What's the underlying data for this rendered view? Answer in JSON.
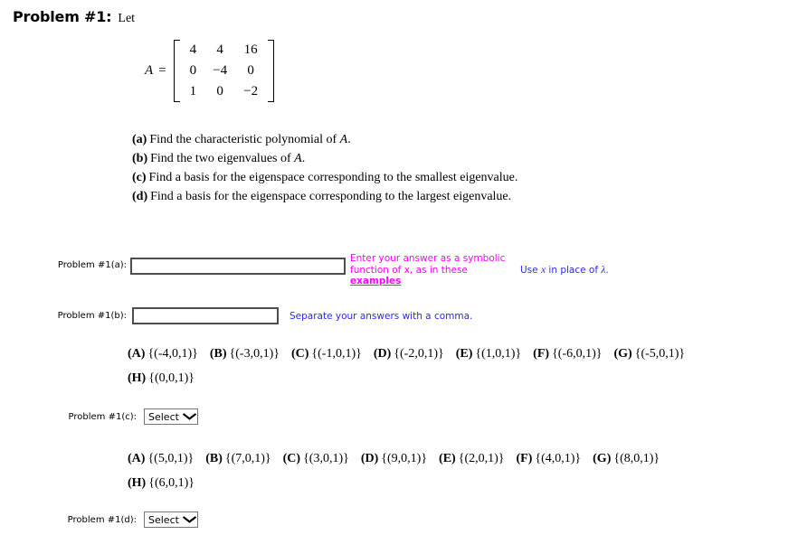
{
  "header": {
    "problem_title": "Problem #1:",
    "intro": "Let"
  },
  "matrix": {
    "lhs": "A",
    "equals": "=",
    "rows": [
      [
        "4",
        "4",
        "16"
      ],
      [
        "0",
        "−4",
        "0"
      ],
      [
        "1",
        "0",
        "−2"
      ]
    ]
  },
  "subquestions": [
    {
      "label": "(a)",
      "text_before": "Find the characteristic polynomial of",
      "var": "A",
      "text_after": "."
    },
    {
      "label": "(b)",
      "text_before": "Find the two eigenvalues of",
      "var": "A",
      "text_after": "."
    },
    {
      "label": "(c)",
      "text_before": "Find a basis for the eigenspace corresponding to the smallest eigenvalue.",
      "var": "",
      "text_after": ""
    },
    {
      "label": "(d)",
      "text_before": "Find a basis for the eigenspace corresponding to the largest eigenvalue.",
      "var": "",
      "text_after": ""
    }
  ],
  "answers": {
    "part_a": {
      "label": "Problem #1(a):",
      "value": "",
      "placeholder": "",
      "hint_magenta_line1": "Enter your answer as a symbolic",
      "hint_magenta_line2": "function of x, as in these",
      "hint_link": "examples",
      "hint_blue_prefix": "Use ",
      "hint_blue_var": "x",
      "hint_blue_middle": " in place of ",
      "hint_blue_lambda": "λ",
      "hint_blue_suffix": "."
    },
    "part_b": {
      "label": "Problem #1(b):",
      "value": "",
      "placeholder": "",
      "hint_blue": "Separate your answers with a comma."
    },
    "part_c": {
      "label": "Problem #1(c):",
      "select_value": "Select",
      "caret": "⌄",
      "choices": [
        {
          "key": "(A)",
          "value": "{(-4,0,1)}"
        },
        {
          "key": "(B)",
          "value": "{(-3,0,1)}"
        },
        {
          "key": "(C)",
          "value": "{(-1,0,1)}"
        },
        {
          "key": "(D)",
          "value": "{(-2,0,1)}"
        },
        {
          "key": "(E)",
          "value": "{(1,0,1)}"
        },
        {
          "key": "(F)",
          "value": "{(-6,0,1)}"
        },
        {
          "key": "(G)",
          "value": "{(-5,0,1)}"
        },
        {
          "key": "(H)",
          "value": "{(0,0,1)}"
        }
      ]
    },
    "part_d": {
      "label": "Problem #1(d):",
      "select_value": "Select",
      "caret": "⌄",
      "choices": [
        {
          "key": "(A)",
          "value": "{(5,0,1)}"
        },
        {
          "key": "(B)",
          "value": "{(7,0,1)}"
        },
        {
          "key": "(C)",
          "value": "{(3,0,1)}"
        },
        {
          "key": "(D)",
          "value": "{(9,0,1)}"
        },
        {
          "key": "(E)",
          "value": "{(2,0,1)}"
        },
        {
          "key": "(F)",
          "value": "{(4,0,1)}"
        },
        {
          "key": "(G)",
          "value": "{(8,0,1)}"
        },
        {
          "key": "(H)",
          "value": "{(6,0,1)}"
        }
      ]
    }
  },
  "colors": {
    "hint_magenta": "#ff00ff",
    "hint_blue": "#2a2aee",
    "input_border": "#4d4d4d"
  }
}
